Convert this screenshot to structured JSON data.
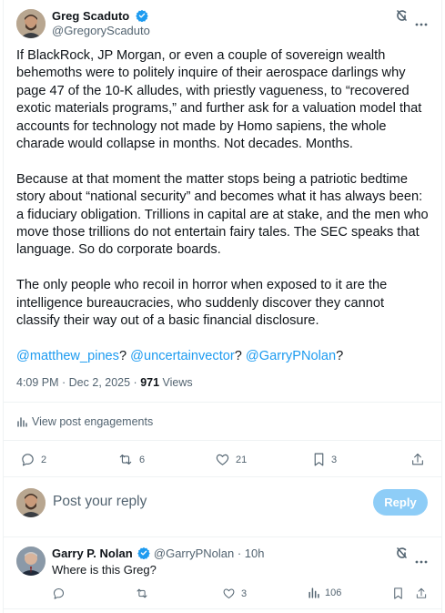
{
  "tweet": {
    "author_name": "Greg Scaduto",
    "author_handle": "@GregoryScaduto",
    "paragraphs": [
      "If BlackRock, JP Morgan, or even a couple of sovereign wealth behemoths were to politely inquire of their aerospace darlings why page 47 of the 10-K alludes, with priestly vagueness, to “recovered exotic materials programs,” and further ask for a valuation model that accounts for technology not made by Homo sapiens, the whole charade would collapse in months. Not decades. Months.",
      "Because at that moment the matter stops being a patriotic bedtime story about “national security” and becomes what it has always been: a fiduciary obligation. Trillions in capital are at stake, and the men who move those trillions do not entertain fairy tales. The SEC speaks that language. So do corporate boards.",
      "The only people who recoil in horror when exposed to it are the intelligence bureaucracies, who suddenly discover they cannot classify their way out of a basic financial disclosure."
    ],
    "mentions": [
      "@matthew_pines",
      "@uncertainvector",
      "@GarryPNolan"
    ],
    "mention_sep_1": "? ",
    "mention_sep_2": "? ",
    "mention_end": "?",
    "timestamp": "4:09 PM · Dec 2, 2025 · ",
    "views_count": "971",
    "views_label": " Views",
    "engagements_label": "View post engagements",
    "actions": {
      "replies": "2",
      "reposts": "6",
      "likes": "21",
      "bookmarks": "3"
    }
  },
  "composer": {
    "placeholder": "Post your reply",
    "button_label": "Reply"
  },
  "reply": {
    "author_name": "Garry P. Nolan",
    "author_handle": "@GarryPNolan",
    "time": "· 10h",
    "text": "Where is this Greg?",
    "actions": {
      "replies": "",
      "reposts": "",
      "likes": "3",
      "views": "106"
    }
  },
  "colors": {
    "accent": "#1d9bf0",
    "verified": "#1d9bf0",
    "text": "#0f1419",
    "muted": "#536471",
    "reply_button": "#8ecdf7"
  }
}
